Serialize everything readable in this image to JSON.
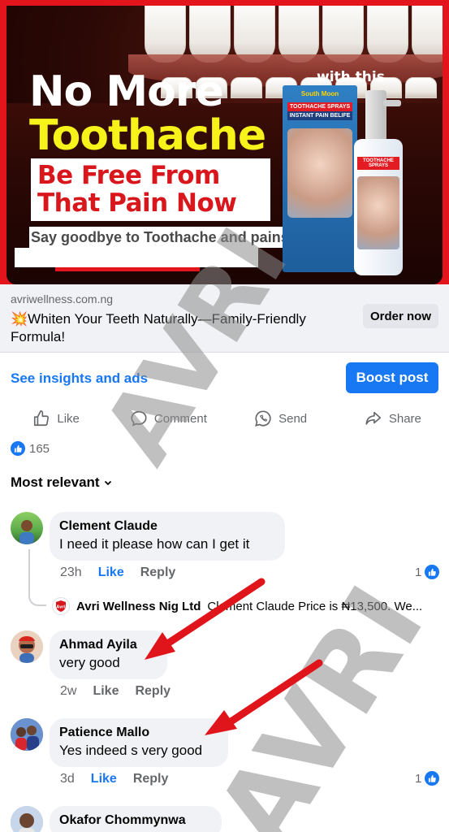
{
  "ad": {
    "headline_line1": "No More",
    "headline_line2": "Toothache",
    "promo_line1": "Be Free From",
    "promo_line2": "That Pain Now",
    "tagline": "Say goodbye to Toothache and pains",
    "with_this": "with this",
    "product_brand": "South Moon",
    "product_label1": "TOOTHACHE SPRAYS",
    "product_label2": "INSTANT PAIN BELIFE",
    "bottle_label": "TOOTHACHE SPRAYS",
    "domain": "avriwellness.com.ng",
    "title_emoji": "💥",
    "title": "Whiten Your Teeth Naturally—Family-Friendly Formula!",
    "order_button": "Order now"
  },
  "insights": {
    "link": "See insights and ads",
    "boost_button": "Boost post"
  },
  "actions": {
    "like": "Like",
    "comment": "Comment",
    "send": "Send",
    "share": "Share"
  },
  "reactions": {
    "count": "165"
  },
  "sort_label": "Most relevant",
  "comments": [
    {
      "name": "Clement Claude",
      "text": "I need it please how can I get it",
      "time": "23h",
      "like": "Like",
      "reply": "Reply",
      "like_count": "1",
      "liked": true
    },
    {
      "name": "Ahmad Ayila",
      "text": "very good",
      "time": "2w",
      "like": "Like",
      "reply": "Reply"
    },
    {
      "name": "Patience Mallo",
      "text": "Yes indeed s very good",
      "time": "3d",
      "like": "Like",
      "reply": "Reply",
      "like_count": "1",
      "liked": true
    },
    {
      "name": "Okafor Chommynwa"
    }
  ],
  "reply": {
    "name": "Avri Wellness Nig Ltd",
    "text": "Clement Claude Price is ₦13,500. We...",
    "logo_text": "Avri"
  },
  "watermark": "AVRI",
  "colors": {
    "brand_blue": "#1877f2",
    "ad_red": "#e3141b",
    "headline_yellow": "#f6f21a",
    "arrow_red": "#e0151b",
    "muted_text": "#65676b"
  }
}
